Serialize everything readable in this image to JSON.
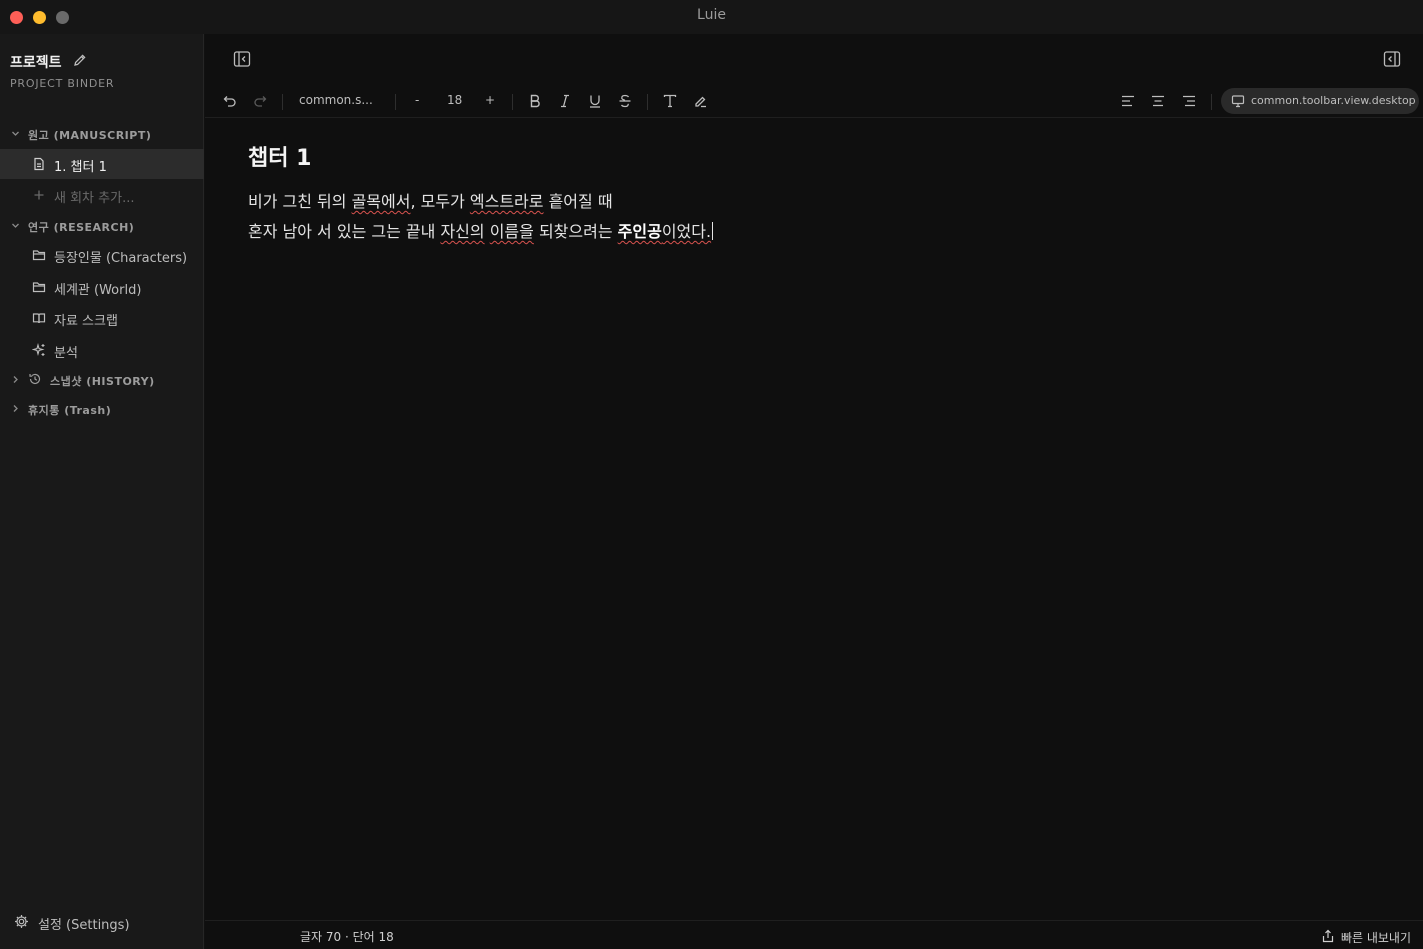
{
  "window": {
    "title": "Luie"
  },
  "sidebar": {
    "project_title": "프로젝트",
    "project_subtitle": "PROJECT BINDER",
    "sections": {
      "manuscript": "원고 (MANUSCRIPT)",
      "research": "연구 (RESEARCH)",
      "history": "스냅샷 (HISTORY)",
      "trash": "휴지통 (Trash)"
    },
    "manuscript_items": [
      "1. 챕터 1"
    ],
    "add_chapter": "새 회차 추가...",
    "research_items": [
      "등장인물 (Characters)",
      "세계관 (World)",
      "자료 스크랩",
      "분석"
    ],
    "settings": "설정 (Settings)"
  },
  "toolbar": {
    "font_family": "common.s...",
    "decrease": "-",
    "font_size": "18",
    "increase": "+",
    "view_mode": "common.toolbar.view.desktop"
  },
  "editor": {
    "title": "챕터 1",
    "line1": {
      "a": "비가 그친 뒤의 ",
      "b": "골목에서",
      "c": ", 모두가 ",
      "d": "엑스트라로",
      "e": " 흩어질 때"
    },
    "line2": {
      "a": "혼자 남아 서 있는 그는 끝내 ",
      "b": "자신의",
      "c": " ",
      "d": "이름을",
      "e": " 되찾으려는 ",
      "f": "주인공",
      "g": "이었다."
    }
  },
  "status": {
    "stats": "글자 70 · 단어 18",
    "export": "빠른 내보내기"
  },
  "colors": {
    "background": "#0f0f0f",
    "sidebar": "#191919",
    "active_item": "#2c2c2c",
    "spell_error": "#d9534f"
  }
}
